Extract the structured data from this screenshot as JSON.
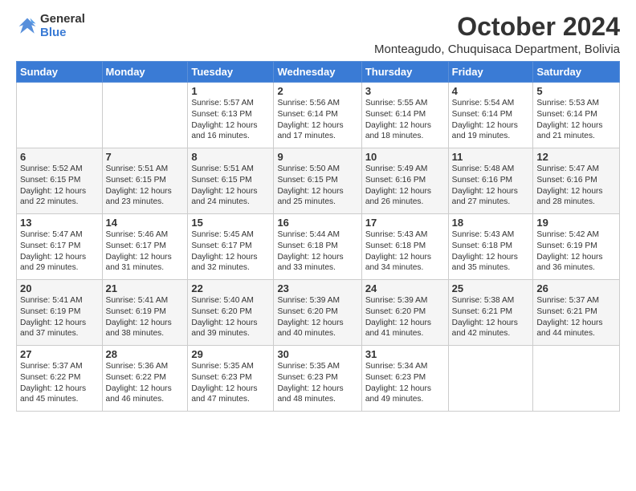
{
  "logo": {
    "general": "General",
    "blue": "Blue"
  },
  "title": "October 2024",
  "subtitle": "Monteagudo, Chuquisaca Department, Bolivia",
  "days_of_week": [
    "Sunday",
    "Monday",
    "Tuesday",
    "Wednesday",
    "Thursday",
    "Friday",
    "Saturday"
  ],
  "weeks": [
    [
      {
        "day": "",
        "info": ""
      },
      {
        "day": "",
        "info": ""
      },
      {
        "day": "1",
        "info": "Sunrise: 5:57 AM\nSunset: 6:13 PM\nDaylight: 12 hours and 16 minutes."
      },
      {
        "day": "2",
        "info": "Sunrise: 5:56 AM\nSunset: 6:14 PM\nDaylight: 12 hours and 17 minutes."
      },
      {
        "day": "3",
        "info": "Sunrise: 5:55 AM\nSunset: 6:14 PM\nDaylight: 12 hours and 18 minutes."
      },
      {
        "day": "4",
        "info": "Sunrise: 5:54 AM\nSunset: 6:14 PM\nDaylight: 12 hours and 19 minutes."
      },
      {
        "day": "5",
        "info": "Sunrise: 5:53 AM\nSunset: 6:14 PM\nDaylight: 12 hours and 21 minutes."
      }
    ],
    [
      {
        "day": "6",
        "info": "Sunrise: 5:52 AM\nSunset: 6:15 PM\nDaylight: 12 hours and 22 minutes."
      },
      {
        "day": "7",
        "info": "Sunrise: 5:51 AM\nSunset: 6:15 PM\nDaylight: 12 hours and 23 minutes."
      },
      {
        "day": "8",
        "info": "Sunrise: 5:51 AM\nSunset: 6:15 PM\nDaylight: 12 hours and 24 minutes."
      },
      {
        "day": "9",
        "info": "Sunrise: 5:50 AM\nSunset: 6:15 PM\nDaylight: 12 hours and 25 minutes."
      },
      {
        "day": "10",
        "info": "Sunrise: 5:49 AM\nSunset: 6:16 PM\nDaylight: 12 hours and 26 minutes."
      },
      {
        "day": "11",
        "info": "Sunrise: 5:48 AM\nSunset: 6:16 PM\nDaylight: 12 hours and 27 minutes."
      },
      {
        "day": "12",
        "info": "Sunrise: 5:47 AM\nSunset: 6:16 PM\nDaylight: 12 hours and 28 minutes."
      }
    ],
    [
      {
        "day": "13",
        "info": "Sunrise: 5:47 AM\nSunset: 6:17 PM\nDaylight: 12 hours and 29 minutes."
      },
      {
        "day": "14",
        "info": "Sunrise: 5:46 AM\nSunset: 6:17 PM\nDaylight: 12 hours and 31 minutes."
      },
      {
        "day": "15",
        "info": "Sunrise: 5:45 AM\nSunset: 6:17 PM\nDaylight: 12 hours and 32 minutes."
      },
      {
        "day": "16",
        "info": "Sunrise: 5:44 AM\nSunset: 6:18 PM\nDaylight: 12 hours and 33 minutes."
      },
      {
        "day": "17",
        "info": "Sunrise: 5:43 AM\nSunset: 6:18 PM\nDaylight: 12 hours and 34 minutes."
      },
      {
        "day": "18",
        "info": "Sunrise: 5:43 AM\nSunset: 6:18 PM\nDaylight: 12 hours and 35 minutes."
      },
      {
        "day": "19",
        "info": "Sunrise: 5:42 AM\nSunset: 6:19 PM\nDaylight: 12 hours and 36 minutes."
      }
    ],
    [
      {
        "day": "20",
        "info": "Sunrise: 5:41 AM\nSunset: 6:19 PM\nDaylight: 12 hours and 37 minutes."
      },
      {
        "day": "21",
        "info": "Sunrise: 5:41 AM\nSunset: 6:19 PM\nDaylight: 12 hours and 38 minutes."
      },
      {
        "day": "22",
        "info": "Sunrise: 5:40 AM\nSunset: 6:20 PM\nDaylight: 12 hours and 39 minutes."
      },
      {
        "day": "23",
        "info": "Sunrise: 5:39 AM\nSunset: 6:20 PM\nDaylight: 12 hours and 40 minutes."
      },
      {
        "day": "24",
        "info": "Sunrise: 5:39 AM\nSunset: 6:20 PM\nDaylight: 12 hours and 41 minutes."
      },
      {
        "day": "25",
        "info": "Sunrise: 5:38 AM\nSunset: 6:21 PM\nDaylight: 12 hours and 42 minutes."
      },
      {
        "day": "26",
        "info": "Sunrise: 5:37 AM\nSunset: 6:21 PM\nDaylight: 12 hours and 44 minutes."
      }
    ],
    [
      {
        "day": "27",
        "info": "Sunrise: 5:37 AM\nSunset: 6:22 PM\nDaylight: 12 hours and 45 minutes."
      },
      {
        "day": "28",
        "info": "Sunrise: 5:36 AM\nSunset: 6:22 PM\nDaylight: 12 hours and 46 minutes."
      },
      {
        "day": "29",
        "info": "Sunrise: 5:35 AM\nSunset: 6:23 PM\nDaylight: 12 hours and 47 minutes."
      },
      {
        "day": "30",
        "info": "Sunrise: 5:35 AM\nSunset: 6:23 PM\nDaylight: 12 hours and 48 minutes."
      },
      {
        "day": "31",
        "info": "Sunrise: 5:34 AM\nSunset: 6:23 PM\nDaylight: 12 hours and 49 minutes."
      },
      {
        "day": "",
        "info": ""
      },
      {
        "day": "",
        "info": ""
      }
    ]
  ]
}
